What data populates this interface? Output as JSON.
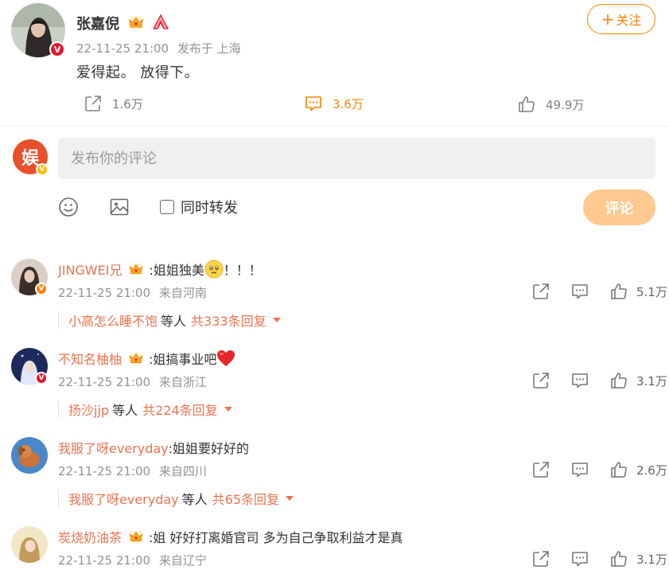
{
  "post": {
    "author": "张嘉倪",
    "time": "22-11-25 21:00",
    "source": "发布于 上海",
    "text": "爱得起。 放得下。",
    "follow_label": "关注",
    "repost_count": "1.6万",
    "comment_count": "3.6万",
    "like_count": "49.9万"
  },
  "composer": {
    "placeholder": "发布你的评论",
    "repost_checkbox_label": "同时转发",
    "submit_label": "评论",
    "avatar_text": "娱"
  },
  "comments": [
    {
      "user": "JINGWEI兄",
      "text_before": ":姐姐独美",
      "text_after": "！！！",
      "emoji": "sad-face-emoji",
      "time": "22-11-25 21:00",
      "location": "来自河南",
      "likes": "5.1万",
      "reply_user": "小高怎么睡不饱",
      "reply_mid": "等人",
      "reply_count": "共333条回复"
    },
    {
      "user": "不知名柚柚",
      "text_before": ":姐搞事业吧",
      "text_after": "",
      "emoji": "red-heart-emoji",
      "time": "22-11-25 21:00",
      "location": "来自浙江",
      "likes": "3.1万",
      "reply_user": "扬沙jjp",
      "reply_mid": "等人",
      "reply_count": "共224条回复"
    },
    {
      "user": "我服了呀everyday",
      "text_before": ":姐姐要好好的",
      "text_after": "",
      "time": "22-11-25 21:00",
      "location": "来自四川",
      "likes": "2.6万",
      "reply_user": "我服了呀everyday",
      "reply_mid": "等人",
      "reply_count": "共65条回复"
    },
    {
      "user": "炭烧奶油茶",
      "text_before": ":姐 好好打离婚官司 多为自己争取利益才是真",
      "text_after": "",
      "time": "22-11-25 21:00",
      "location": "来自辽宁",
      "likes": "3.1万"
    }
  ],
  "colors": {
    "accent": "#ff8200",
    "username": "#eb7350",
    "muted": "#939393",
    "submit_disabled": "#ffc98f"
  }
}
